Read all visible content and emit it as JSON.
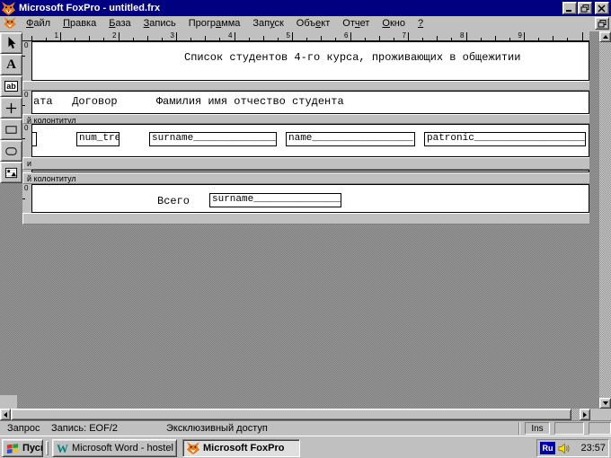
{
  "window": {
    "title": "Microsoft FoxPro - untitled.frx"
  },
  "menu": {
    "items": [
      {
        "label": "Файл",
        "accel": 0
      },
      {
        "label": "Правка",
        "accel": 0
      },
      {
        "label": "База",
        "accel": 0
      },
      {
        "label": "Запись",
        "accel": 0
      },
      {
        "label": "Программа",
        "accel": 5
      },
      {
        "label": "Запуск",
        "accel": 3
      },
      {
        "label": "Объект",
        "accel": 3
      },
      {
        "label": "Отчет",
        "accel": 2
      },
      {
        "label": "Окно",
        "accel": 0
      },
      {
        "label": "?",
        "accel": 0
      }
    ]
  },
  "toolbox": {
    "tools": [
      "pointer-tool",
      "text-tool",
      "field-tool",
      "line-tool",
      "rectangle-tool",
      "rounded-rectangle-tool",
      "picture-tool"
    ],
    "field_tool_glyph": "ab",
    "text_tool_glyph": "A"
  },
  "ruler": {
    "numbers": [
      "1",
      "2",
      "3",
      "4",
      "5",
      "6",
      "7",
      "8",
      "9"
    ]
  },
  "report": {
    "zero": "0",
    "title_text": "Список студентов 4-го курса, проживающих в общежитии",
    "page_header_text": "ата   Договор      Фамилия имя отчество студента",
    "band_bars": [
      "",
      "й колонтитул",
      "и",
      "й колонтитул",
      ""
    ],
    "fields": {
      "num": "num_tre",
      "surname": "surname______________",
      "name": "name_________________",
      "patronic": "patronic___________________"
    },
    "summary_label": "Всего",
    "summary_field": "surname_______________"
  },
  "statusbar": {
    "left": "Запрос",
    "record": "Запись: EOF/2",
    "access": "Эксклюзивный доступ",
    "ins": "Ins"
  },
  "taskbar": {
    "start_label": "Пуск",
    "word_label": "Microsoft Word - hostel",
    "foxpro_label": "Microsoft FoxPro",
    "tray": {
      "lang": "Ru",
      "clock": "23:57"
    }
  },
  "colors": {
    "titlebar": "#000080",
    "chrome": "#c0c0c0",
    "desktop_dither": "#8c8c8c",
    "band_white": "#ffffff",
    "tray_lang_bg": "#0000a8",
    "fox_orange": "#e97817"
  }
}
